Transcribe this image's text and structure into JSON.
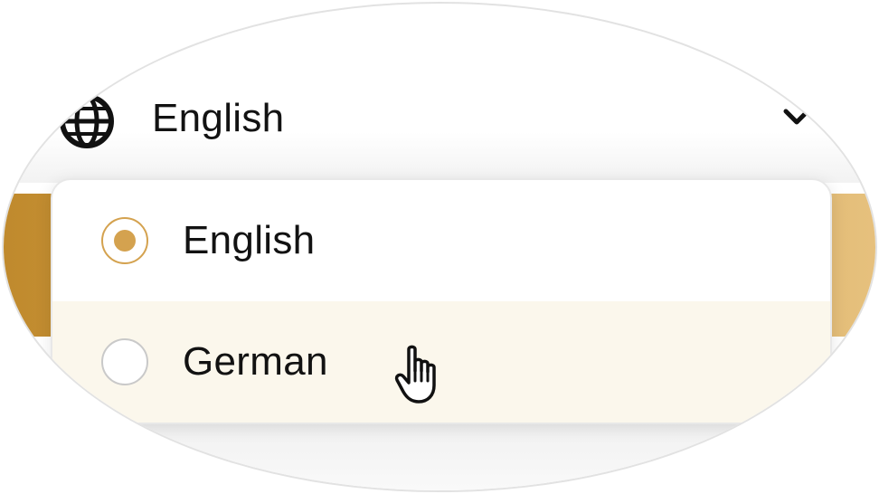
{
  "language_selector": {
    "current_value": "English",
    "globe_icon": "globe-icon",
    "chevron_icon": "chevron-down-icon"
  },
  "menu": {
    "options": [
      {
        "label": "English",
        "selected": true
      },
      {
        "label": "German",
        "selected": false,
        "hovered": true
      }
    ]
  },
  "cursor_icon": "pointer-hand-icon",
  "colors": {
    "accent": "#d4a24f",
    "hover_bg": "#fbf7ec",
    "band_left": "#c08a2d",
    "band_right": "#e6c17e",
    "text": "#121212"
  }
}
